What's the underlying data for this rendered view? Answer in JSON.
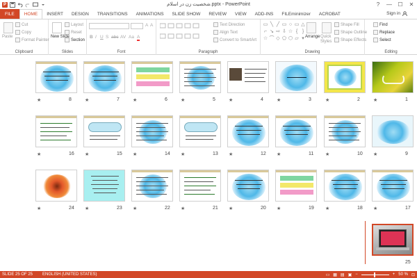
{
  "window": {
    "title": "شخصیت زن در اسلام.pptx - PowerPoint",
    "app_icon": "P",
    "controls": [
      "?",
      "—",
      "☐",
      "✕"
    ]
  },
  "ribbon": {
    "tabs": [
      "FILE",
      "HOME",
      "INSERT",
      "DESIGN",
      "TRANSITIONS",
      "ANIMATIONS",
      "SLIDE SHOW",
      "REVIEW",
      "VIEW",
      "ADD-INS",
      "FILEminimizer",
      "ACROBAT"
    ],
    "active_tab": "HOME",
    "signin": "Sign in",
    "clipboard": {
      "label": "Clipboard",
      "paste": "Paste",
      "cut": "Cut",
      "copy": "Copy",
      "format_painter": "Format Painter"
    },
    "slides": {
      "label": "Slides",
      "new_slide": "New Slide",
      "layout": "Layout",
      "reset": "Reset",
      "section": "Section"
    },
    "font": {
      "label": "Font",
      "bold": "B",
      "italic": "I",
      "underline": "U",
      "shadow": "S",
      "strike": "abc",
      "spacing": "AV",
      "case": "Aa",
      "color": "A"
    },
    "paragraph": {
      "label": "Paragraph",
      "text_direction": "Text Direction",
      "align_text": "Align Text",
      "convert_smartart": "Convert to SmartArt"
    },
    "drawing": {
      "label": "Drawing",
      "arrange": "Arrange",
      "quick_styles": "Quick Styles",
      "shape_fill": "Shape Fill",
      "shape_outline": "Shape Outline",
      "shape_effects": "Shape Effects"
    },
    "editing": {
      "label": "Editing",
      "find": "Find",
      "replace": "Replace",
      "select": "Select"
    }
  },
  "slides": [
    {
      "num": "1",
      "style": "green-calligraphy"
    },
    {
      "num": "2",
      "style": "yellow-frame"
    },
    {
      "num": "3",
      "style": "blue-title"
    },
    {
      "num": "4",
      "style": "photo-text"
    },
    {
      "num": "5",
      "style": "text-lines"
    },
    {
      "num": "6",
      "style": "colorful-boxes"
    },
    {
      "num": "7",
      "style": "blue-text"
    },
    {
      "num": "8",
      "style": "blue-text"
    },
    {
      "num": "9",
      "style": "teal-cloud"
    },
    {
      "num": "10",
      "style": "text-lines"
    },
    {
      "num": "11",
      "style": "blue-text"
    },
    {
      "num": "12",
      "style": "blue-text"
    },
    {
      "num": "13",
      "style": "banner"
    },
    {
      "num": "14",
      "style": "text-lines"
    },
    {
      "num": "15",
      "style": "banner"
    },
    {
      "num": "16",
      "style": "green-items"
    },
    {
      "num": "17",
      "style": "blue-text"
    },
    {
      "num": "18",
      "style": "blue-text"
    },
    {
      "num": "19",
      "style": "colorful-boxes"
    },
    {
      "num": "20",
      "style": "blue-text"
    },
    {
      "num": "21",
      "style": "green-items"
    },
    {
      "num": "22",
      "style": "text-lines"
    },
    {
      "num": "23",
      "style": "cyan-text"
    },
    {
      "num": "24",
      "style": "flower"
    },
    {
      "num": "25",
      "style": "laptop"
    }
  ],
  "status": {
    "slide_info": "SLIDE 25 OF 25",
    "language": "ENGLISH (UNITED STATES)",
    "zoom": "50 %"
  },
  "colors": {
    "accent": "#d24726"
  }
}
